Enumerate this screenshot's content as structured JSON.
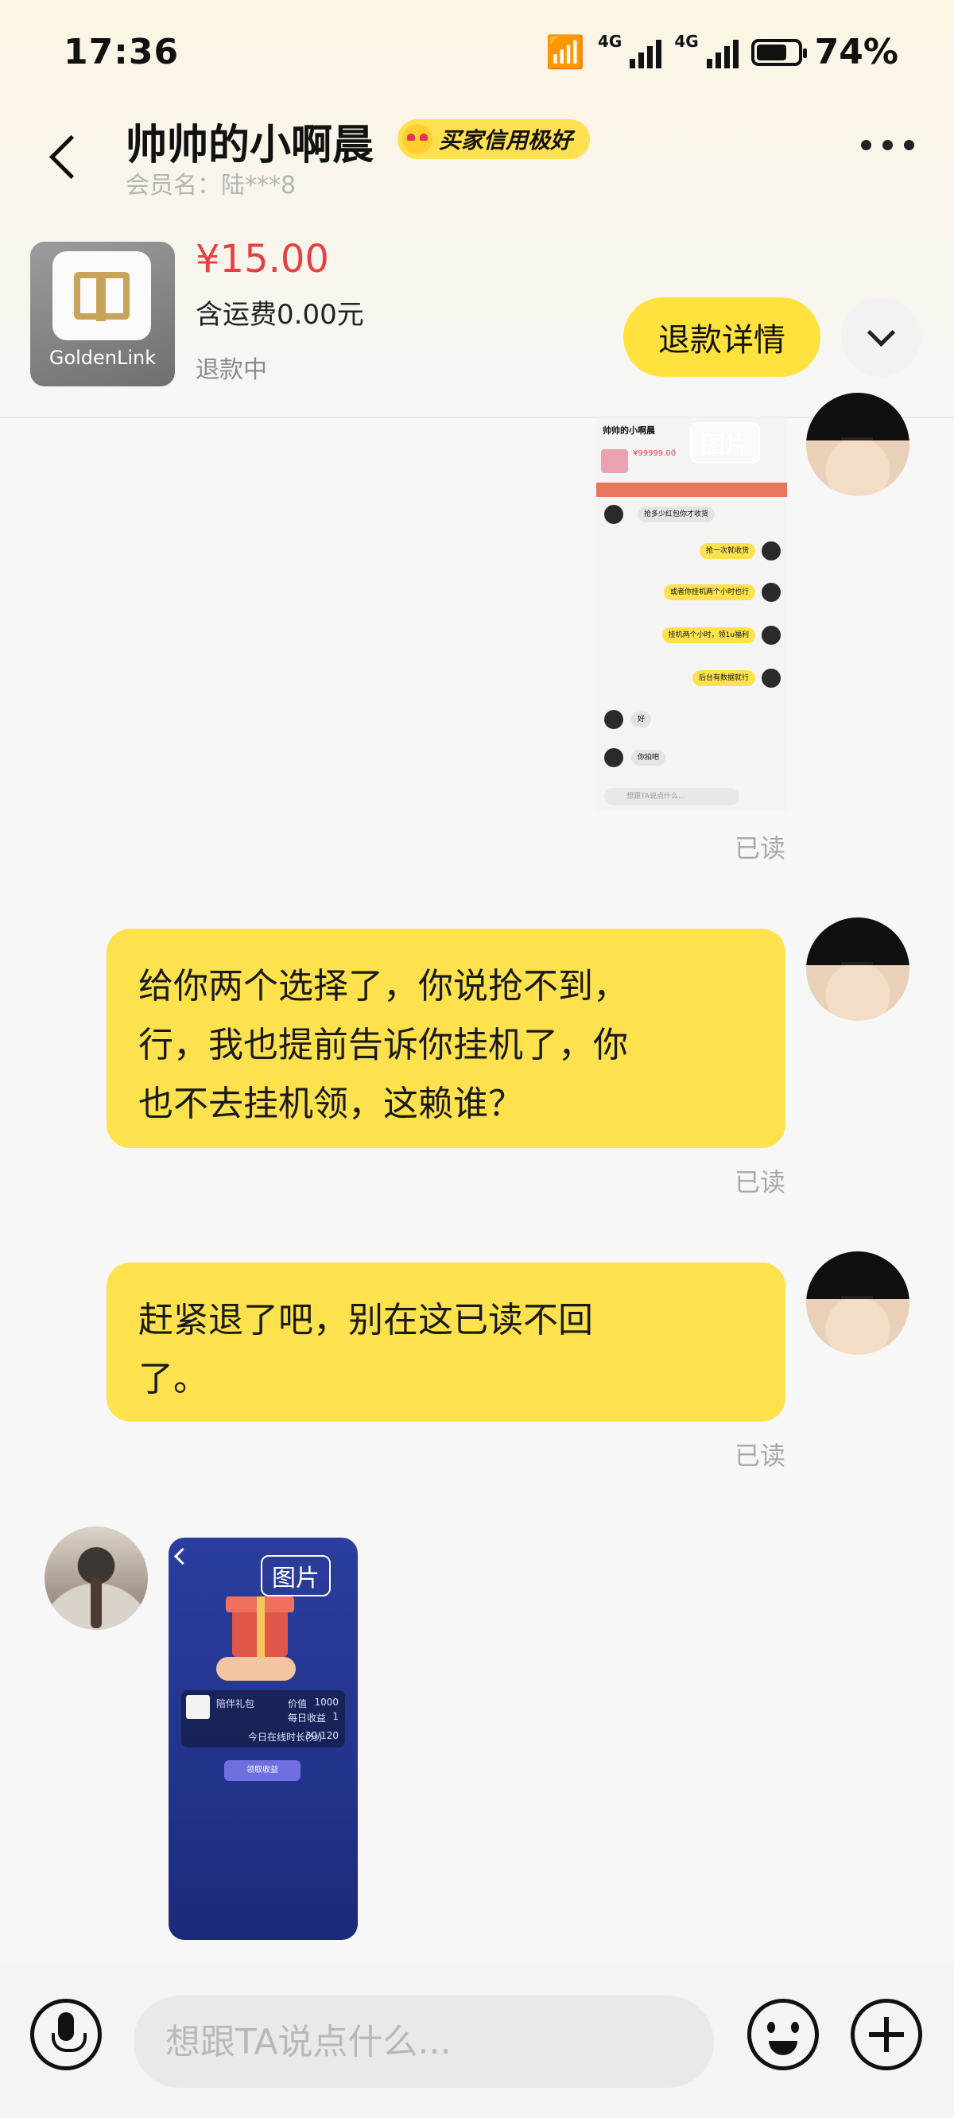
{
  "status_bar": {
    "time": "17:36",
    "network_1": "4G",
    "network_2": "4G",
    "battery": "74%",
    "battery_level": 0.74
  },
  "header": {
    "title": "帅帅的小啊晨",
    "credit_badge": "买家信用极好",
    "member_label": "会员名：陆***8"
  },
  "product": {
    "image_brand": "GoldenLink",
    "price": "¥15.00",
    "shipping": "含运费0.00元",
    "status": "退款中",
    "refund_button": "退款详情"
  },
  "messages": [
    {
      "type": "image",
      "side": "me",
      "tag": "图片",
      "read_status": "已读",
      "content": {
        "title": "帅帅的小啊晨",
        "price": "¥99999.00",
        "lines": [
          "抢多少红包你才收货",
          "抢一次就收货",
          "或者你挂机两个小时也行",
          "挂机两个小时，领1u福利",
          "后台有数据就行",
          "好",
          "你拍吧"
        ],
        "input_placeholder": "想跟TA说点什么..."
      }
    },
    {
      "type": "text",
      "side": "me",
      "lines": [
        "给你两个选择了，你说抢不到，",
        "行，我也提前告诉你挂机了，你",
        "也不去挂机领，这赖谁？"
      ],
      "read_status": "已读"
    },
    {
      "type": "text",
      "side": "me",
      "lines": [
        "赶紧退了吧，别在这已读不回",
        "了。"
      ],
      "read_status": "已读"
    },
    {
      "type": "image",
      "side": "other",
      "tag": "图片",
      "content": {
        "item": "陪伴礼包",
        "price_label": "价值",
        "price": "1000",
        "daily_label": "每日收益",
        "daily": "1",
        "progress_label": "今日在线时长(分)",
        "progress": "30/120",
        "button": "领取收益"
      }
    }
  ],
  "input_bar": {
    "placeholder": "想跟TA说点什么..."
  },
  "colors": {
    "accent_yellow": "#fde24d",
    "price_red": "#e64040",
    "read_grey": "#a8a8a8"
  }
}
